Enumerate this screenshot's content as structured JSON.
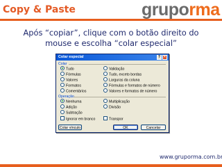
{
  "slide": {
    "title": "Copy & Paste",
    "logo_part1": "grupo",
    "logo_part2": "rma",
    "instruction_line1": "Após “copiar”, clique com o botão direito do",
    "instruction_line2": "mouse e escolha “colar especial”",
    "website": "www.gruporma.com.br",
    "accent_color": "#e75f1e",
    "text_color": "#202a6e"
  },
  "dialog": {
    "title": "Colar especial",
    "help_glyph": "?",
    "close_glyph": "×",
    "paste_label": "Colar",
    "paste_options_left": [
      "Tudo",
      "Fórmulas",
      "Valores",
      "Formatos",
      "Comentários"
    ],
    "paste_options_right": [
      "Validação",
      "Tudo, exceto bordas",
      "Larguras da coluna",
      "Fórmulas e formatos de número",
      "Valores e formatos de número"
    ],
    "paste_selected": "Tudo",
    "operation_label": "Operação",
    "operation_options_left": [
      "Nenhuma",
      "Adição",
      "Subtração"
    ],
    "operation_options_right": [
      "Multiplicação",
      "Divisão"
    ],
    "operation_selected": "Nenhuma",
    "skip_blanks_label": "Ignorar em branco",
    "transpose_label": "Transpor",
    "paste_link_button": "Colar vínculo",
    "ok_button": "OK",
    "cancel_button": "Cancelar"
  }
}
